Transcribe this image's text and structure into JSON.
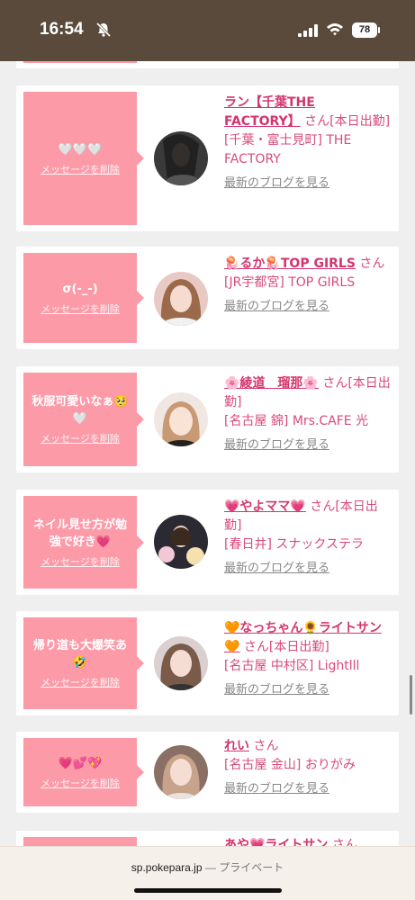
{
  "status": {
    "time": "16:54",
    "battery": "78"
  },
  "browser": {
    "domain": "sp.pokepara.jp",
    "mode": "— プライベート"
  },
  "delete_label": "メッセージを削除",
  "blog_label": "最新のブログを見る",
  "san_label": "さん",
  "messages": [
    {
      "message": "🤍🤍🤍",
      "name": "ラン【千葉THE FACTORY】",
      "suffix": "さん[本日出勤]",
      "shop": "[千葉・富士見町] THE FACTORY"
    },
    {
      "message": "σ(-_-)",
      "name": "🪼るか🪼TOP GIRLS",
      "suffix": "さん",
      "shop": "[JR宇都宮] TOP GIRLS"
    },
    {
      "message": "秋服可愛いなぁ🥺🤍",
      "name": "🌸綾道　瑠那🌸",
      "suffix": "さん[本日出勤]",
      "shop": "[名古屋 錦] Mrs.CAFE 光"
    },
    {
      "message": "ネイル見せ方が勉強で好き💗",
      "name": "💗やよママ💗",
      "suffix": "さん[本日出勤]",
      "shop": "[春日井] スナックステラ"
    },
    {
      "message": "帰り道も大爆笑あ🤣",
      "name": "🧡なっちゃん🌻ライトサン🧡",
      "suffix": "さん[本日出勤]",
      "shop": "[名古屋 中村区] Lightlll"
    },
    {
      "message": "💗💕💖",
      "name": "れい",
      "suffix": "さん",
      "shop": "[名古屋 金山] おりがみ"
    },
    {
      "message": "",
      "name": "あや💗ライトサン",
      "suffix": "さん",
      "shop": ""
    }
  ]
}
